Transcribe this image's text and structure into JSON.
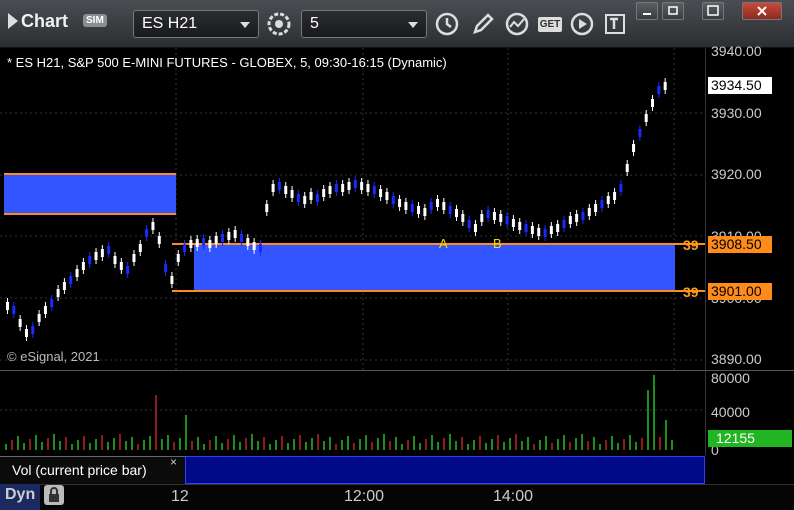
{
  "toolbar": {
    "app_title": "Chart",
    "sim_badge": "SIM",
    "symbol_value": "ES H21",
    "interval_value": "5",
    "get_label": "GET"
  },
  "chart": {
    "title": "* ES H21, S&P 500 E-MINI FUTURES - GLOBEX, 5, 09:30-16:15 (Dynamic)",
    "copyright": "© eSignal, 2021",
    "annotation_a": "A",
    "annotation_b": "B",
    "zone_label_upper": "39",
    "zone_label_lower": "39"
  },
  "price_axis": {
    "ticks": [
      "3940.00",
      "3930.00",
      "3920.00",
      "3910.00",
      "3900.00",
      "3890.00"
    ],
    "current_price": "3934.50",
    "zone_upper_price": "3908.50",
    "zone_lower_price": "3901.00"
  },
  "volume": {
    "pane_label": "Vol (current price bar)",
    "close_symbol": "×",
    "ticks": [
      "80000",
      "40000",
      "0"
    ],
    "current_value": "12155"
  },
  "time_axis": {
    "mode_label": "Dyn",
    "labels": [
      "12",
      "12:00",
      "14:00"
    ]
  },
  "colors": {
    "zone_fill": "#3355ff",
    "zone_border": "#ff8c1a",
    "up_candle": "#ffffff",
    "down_candle": "#1a2aff",
    "vol_up": "#22c022",
    "vol_down": "#c02222",
    "current_price_box": "#ffffff",
    "zone_price_box": "#ff8c1a",
    "volume_box": "#22b522"
  },
  "icons": [
    "chart-triangle-icon",
    "dropdown-arrow-icon",
    "settings-gear-icon",
    "clock-icon",
    "pencil-icon",
    "study-icon",
    "get-icon",
    "play-icon",
    "text-tool-icon",
    "minimize-icon",
    "restore-icon",
    "maximize-icon",
    "close-icon",
    "lock-icon"
  ]
}
